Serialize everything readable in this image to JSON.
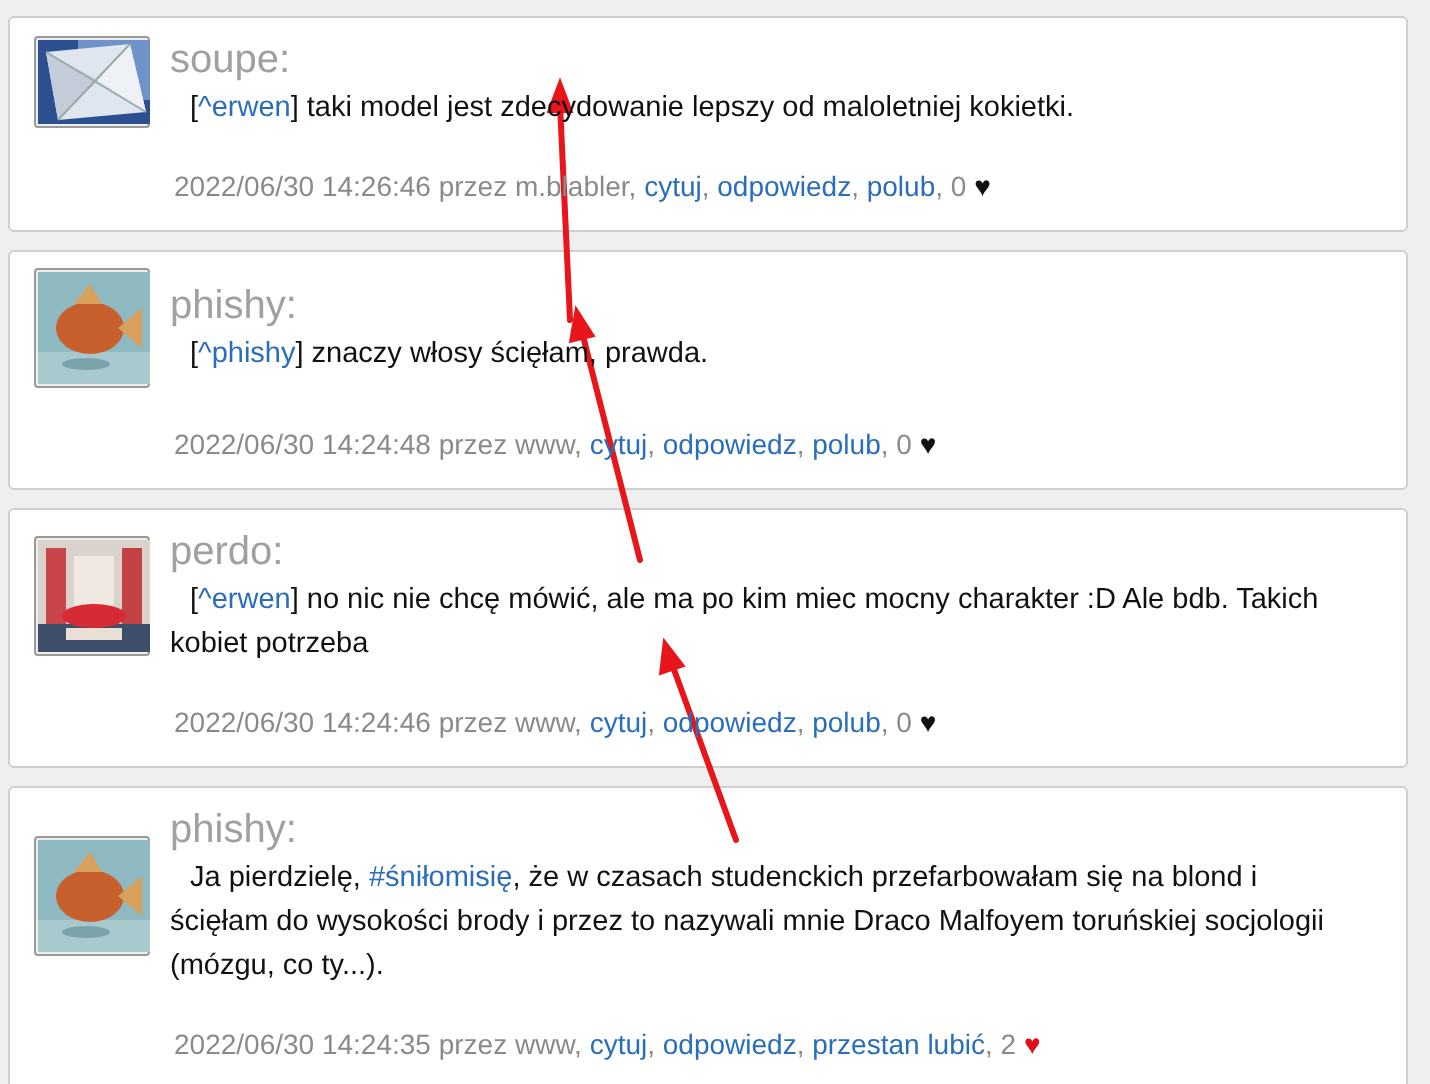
{
  "posts": [
    {
      "author": "soupe:",
      "body": [
        {
          "kind": "text",
          "text": "["
        },
        {
          "kind": "link",
          "text": "^erwen"
        },
        {
          "kind": "text",
          "text": "] taki model jest zdecydowanie lepszy od maloletniej kokietki."
        }
      ],
      "meta": {
        "posted": "2022/06/30 14:26:46 przez m.blabler,",
        "actions": [
          {
            "label": "cytuj",
            "separator": ","
          },
          {
            "label": "odpowiedz",
            "separator": ","
          },
          {
            "label": "polub",
            "separator": ","
          }
        ],
        "likes": "0"
      },
      "heart": {
        "text": "♥",
        "liked": false
      }
    },
    {
      "author": "phishy:",
      "body": [
        {
          "kind": "text",
          "text": "["
        },
        {
          "kind": "link",
          "text": "^phishy"
        },
        {
          "kind": "text",
          "text": "] znaczy włosy ścięłam, prawda."
        }
      ],
      "meta": {
        "posted": "2022/06/30 14:24:48 przez www,",
        "actions": [
          {
            "label": "cytuj",
            "separator": ","
          },
          {
            "label": "odpowiedz",
            "separator": ","
          },
          {
            "label": "polub",
            "separator": ","
          }
        ],
        "likes": "0"
      },
      "heart": {
        "text": "♥",
        "liked": false
      }
    },
    {
      "author": "perdo:",
      "body": [
        {
          "kind": "text",
          "text": "["
        },
        {
          "kind": "link",
          "text": "^erwen"
        },
        {
          "kind": "text",
          "text": "] no nic nie chcę mówić, ale ma po kim miec mocny charakter :D Ale bdb. Takich kobiet potrzeba"
        }
      ],
      "meta": {
        "posted": "2022/06/30 14:24:46 przez www,",
        "actions": [
          {
            "label": "cytuj",
            "separator": ","
          },
          {
            "label": "odpowiedz",
            "separator": ","
          },
          {
            "label": "polub",
            "separator": ","
          }
        ],
        "likes": "0"
      },
      "heart": {
        "text": "♥",
        "liked": false
      }
    },
    {
      "author": "phishy:",
      "body": [
        {
          "kind": "text",
          "text": "Ja pierdzielę, "
        },
        {
          "kind": "link",
          "text": "#śniłomisię"
        },
        {
          "kind": "text",
          "text": ", że w czasach studenckich przefarbowałam się na blond i ścięłam do wysokości brody i przez to nazywali mnie Draco Malfoyem toruńskiej socjologii (mózgu, co ty...)."
        }
      ],
      "meta": {
        "posted": "2022/06/30 14:24:35 przez www,",
        "actions": [
          {
            "label": "cytuj",
            "separator": ","
          },
          {
            "label": "odpowiedz",
            "separator": ","
          },
          {
            "label": "przestan lubić",
            "separator": ","
          }
        ],
        "likes": "2"
      },
      "heart": {
        "text": "♥",
        "liked": true
      }
    }
  ]
}
